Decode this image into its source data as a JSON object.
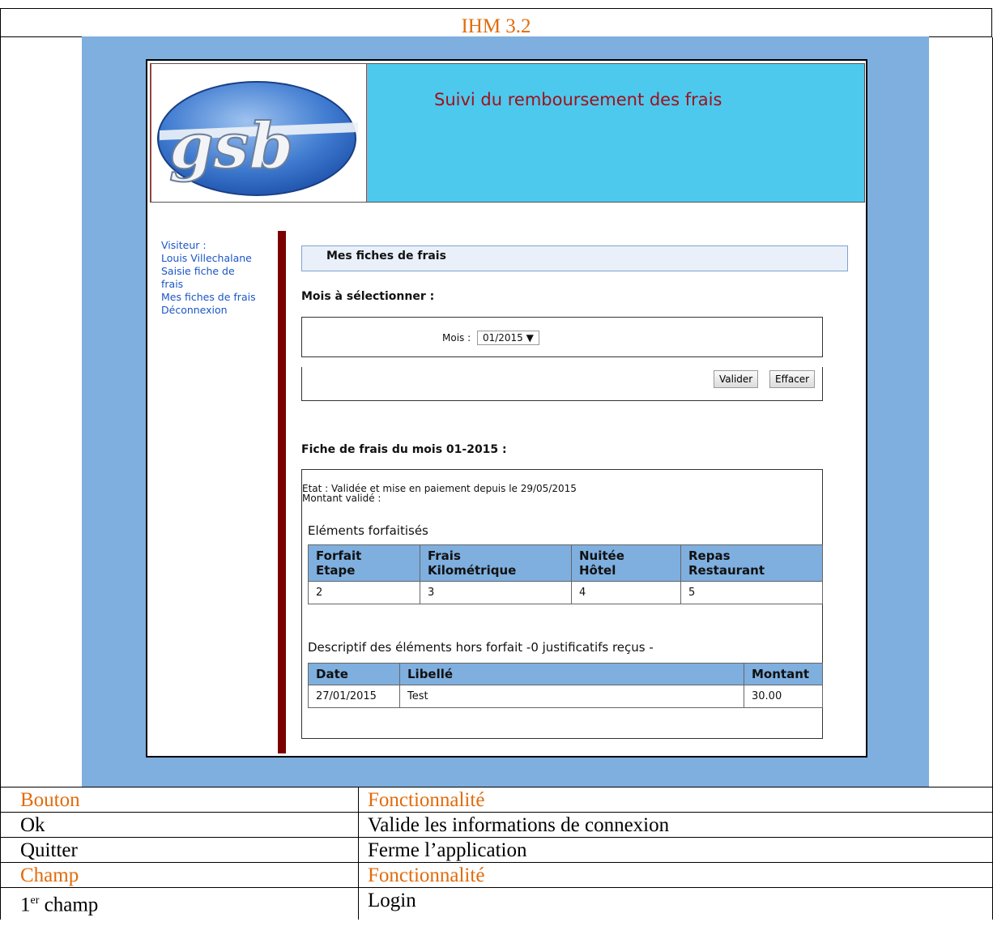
{
  "doc": {
    "title": "IHM 3.2"
  },
  "app": {
    "banner_title": "Suivi du remboursement des frais",
    "logo_text": "gsb",
    "nav": {
      "visitor_label": "Visiteur :",
      "visitor_name": "Louis Villechalane",
      "saisie_line1": "Saisie fiche de",
      "saisie_line2": "frais",
      "mes_fiches": "Mes fiches de frais",
      "deconnexion": "Déconnexion"
    },
    "section_title": "Mes fiches de frais",
    "mois_select_label": "Mois à sélectionner :",
    "mois_label": "Mois :",
    "mois_value": "01/2015",
    "btn_valider": "Valider",
    "btn_effacer": "Effacer",
    "fiche_title": "Fiche de frais du mois 01-2015 :",
    "etat_line": "Etat : Validée et mise en paiement depuis le 29/05/2015",
    "montant_line": "Montant validé :",
    "forfait_title": "Eléments forfaitisés",
    "forfait_headers": [
      [
        "Forfait",
        "Etape"
      ],
      [
        "Frais",
        "Kilométrique"
      ],
      [
        "Nuitée",
        "Hôtel"
      ],
      [
        "Repas",
        "Restaurant"
      ]
    ],
    "forfait_values": [
      "2",
      "3",
      "4",
      "5"
    ],
    "hors_forfait_title": "Descriptif des éléments hors forfait -0 justificatifs reçus -",
    "hors_headers": [
      "Date",
      "Libellé",
      "Montant"
    ],
    "hors_rows": [
      [
        "27/01/2015",
        "Test",
        "30.00"
      ]
    ]
  },
  "table": {
    "header1": [
      "Bouton",
      "Fonctionnalité"
    ],
    "rows1": [
      [
        "Ok",
        "Valide les informations de connexion"
      ],
      [
        "Quitter",
        "Ferme l’application"
      ]
    ],
    "header2": [
      "Champ",
      "Fonctionnalité"
    ],
    "row_champ_num": "1",
    "row_champ_sup": "er",
    "row_champ_rest": " champ",
    "row_champ_value": "Login"
  },
  "colors": {
    "accent_orange": "#e26b0a",
    "bg_blue": "#7eafdf",
    "banner_cyan": "#4dc9ee",
    "dark_red": "#7a0000"
  }
}
